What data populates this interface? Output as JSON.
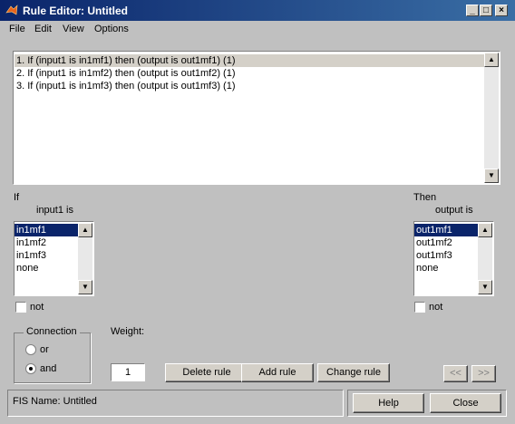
{
  "window": {
    "title": "Rule Editor: Untitled"
  },
  "menu": [
    "File",
    "Edit",
    "View",
    "Options"
  ],
  "rules": [
    "1. If (input1 is in1mf1) then (output is out1mf1) (1)",
    "2. If (input1 is in1mf2) then (output is out1mf2) (1)",
    "3. If (input1 is in1mf3) then (output is out1mf3) (1)"
  ],
  "if_section": {
    "label": "If",
    "input_label": "input1 is",
    "options": [
      "in1mf1",
      "in1mf2",
      "in1mf3",
      "none"
    ],
    "selected": "in1mf1",
    "not_label": "not"
  },
  "then_section": {
    "label": "Then",
    "output_label": "output is",
    "options": [
      "out1mf1",
      "out1mf2",
      "out1mf3",
      "none"
    ],
    "selected": "out1mf1",
    "not_label": "not"
  },
  "connection": {
    "label": "Connection",
    "or_label": "or",
    "and_label": "and",
    "selected": "and"
  },
  "weight": {
    "label": "Weight:",
    "value": "1"
  },
  "buttons": {
    "delete_rule": "Delete rule",
    "add_rule": "Add rule",
    "change_rule": "Change rule",
    "prev": "<<",
    "next": ">>",
    "help": "Help",
    "close": "Close"
  },
  "status": "FIS Name: Untitled",
  "colors": {
    "titlebar": "#0a246a",
    "selection": "#0a246a",
    "face": "#c0c0c0"
  }
}
